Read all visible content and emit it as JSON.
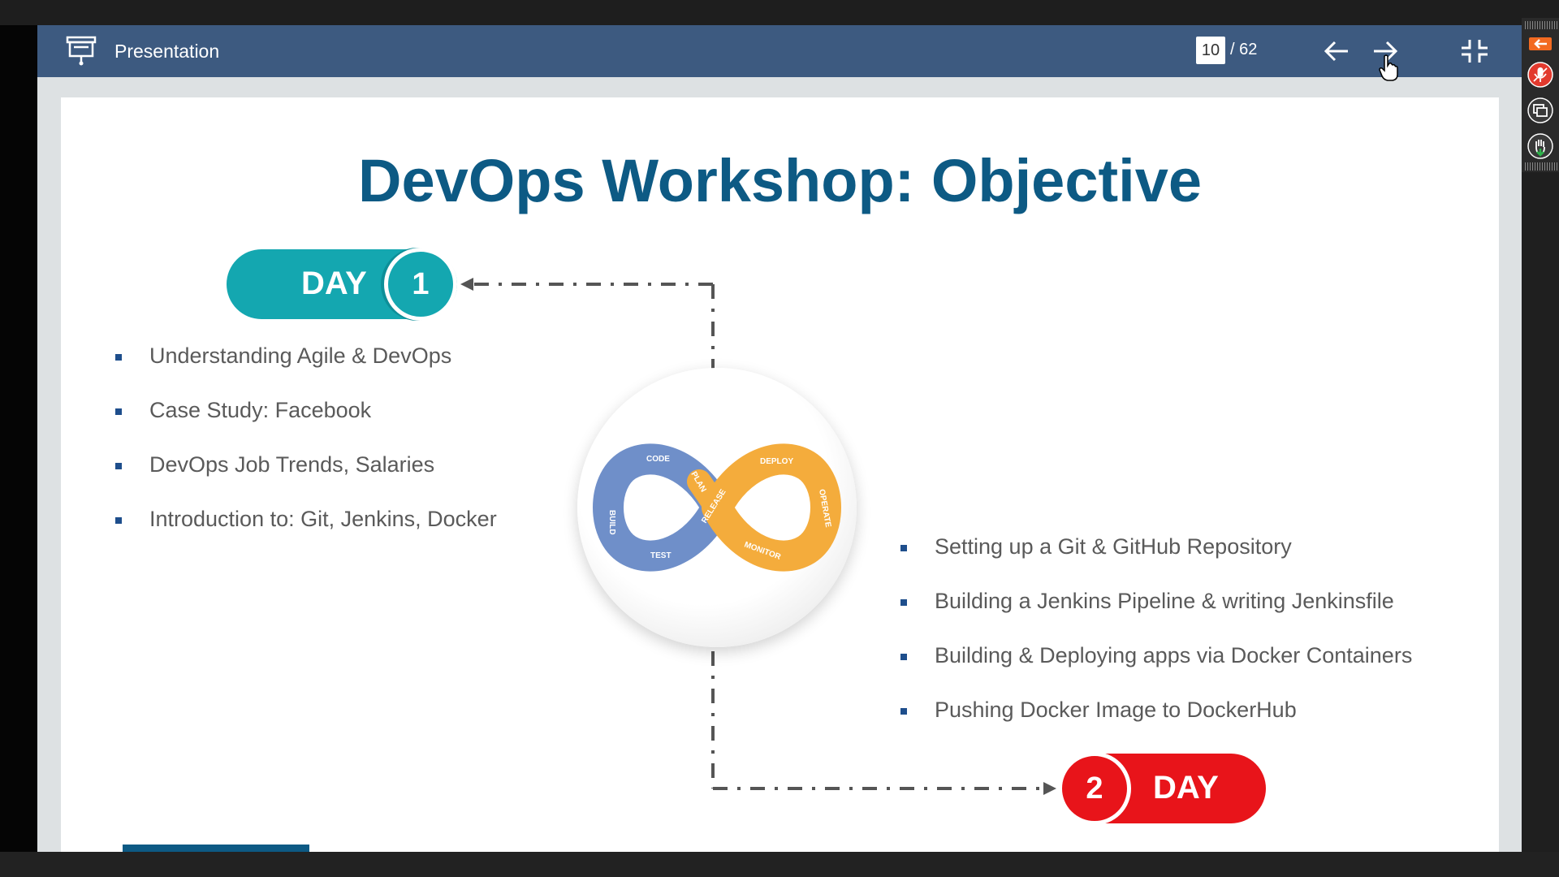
{
  "toolbar": {
    "title": "Presentation",
    "current_page": "10",
    "total_pages": "/ 62",
    "icons": [
      "presentation-icon",
      "arrow-left-icon",
      "arrow-right-icon",
      "exit-fullscreen-icon"
    ]
  },
  "slide": {
    "title": "DevOps Workshop: Objective",
    "day1": {
      "label": "DAY",
      "number": "1",
      "color": "#14a7b0",
      "items": [
        "Understanding Agile & DevOps",
        "Case Study: Facebook",
        "DevOps Job Trends, Salaries",
        "Introduction to: Git, Jenkins, Docker"
      ]
    },
    "day2": {
      "label": "DAY",
      "number": "2",
      "color": "#e8141a",
      "items": [
        "Setting up a Git & GitHub Repository",
        "Building a Jenkins Pipeline & writing Jenkinsfile",
        "Building & Deploying apps via Docker Containers",
        "Pushing Docker Image to DockerHub"
      ]
    },
    "devops_loop": {
      "left_stages": [
        "CODE",
        "BUILD",
        "TEST",
        "PLAN"
      ],
      "right_stages": [
        "RELEASE",
        "DEPLOY",
        "OPERATE",
        "MONITOR"
      ],
      "left_color": "#6f8fc9",
      "right_color": "#f4ac3c"
    }
  },
  "side_panel": {
    "icons": [
      "back-arrow-icon",
      "microphone-muted-icon",
      "screen-share-icon",
      "raise-hand-icon"
    ]
  }
}
